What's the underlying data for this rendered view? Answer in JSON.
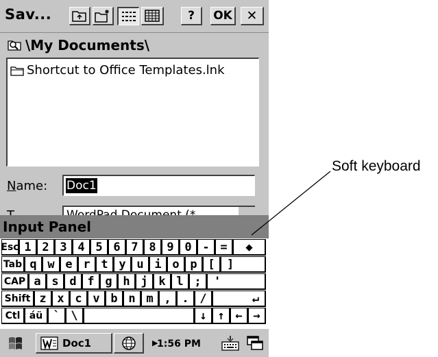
{
  "titlebar": {
    "title": "Sav...",
    "buttons": [
      {
        "name": "up-folder",
        "icon": "up-folder-icon"
      },
      {
        "name": "new-folder",
        "icon": "new-folder-icon"
      },
      {
        "name": "list-view",
        "icon": "list-view-icon",
        "pressed": true
      },
      {
        "name": "details-view",
        "icon": "details-view-icon"
      }
    ],
    "help_label": "?",
    "ok_label": "OK",
    "close_label": "✕"
  },
  "location": {
    "path": "\\My Documents\\"
  },
  "files": [
    {
      "name": "Shortcut to Office Templates.lnk",
      "icon": "folder-shortcut-icon"
    }
  ],
  "name_field": {
    "label_underlined": "N",
    "label_rest": "ame:",
    "value": "Doc1"
  },
  "type_field": {
    "label_visible": "T",
    "value_visible": "WordPad Document (*"
  },
  "input_panel": {
    "title": "Input Panel"
  },
  "keyboard": {
    "rows": [
      [
        "Esc",
        "1",
        "2",
        "3",
        "4",
        "5",
        "6",
        "7",
        "8",
        "9",
        "0",
        "-",
        "=",
        "◆"
      ],
      [
        "Tab",
        "q",
        "w",
        "e",
        "r",
        "t",
        "y",
        "u",
        "i",
        "o",
        "p",
        "[",
        "]"
      ],
      [
        "CAP",
        "a",
        "s",
        "d",
        "f",
        "g",
        "h",
        "j",
        "k",
        "l",
        ";",
        "'"
      ],
      [
        "Shift",
        "z",
        "x",
        "c",
        "v",
        "b",
        "n",
        "m",
        ",",
        ".",
        "/",
        "↵"
      ],
      [
        "Ctl",
        "áü",
        "`",
        "\\",
        "",
        "↓",
        "↑",
        "←",
        "→"
      ]
    ]
  },
  "taskbar": {
    "start_icon": "windows-start-icon",
    "task_label": "Doc1",
    "task_icon": "wordpad-icon",
    "network_icon": "globe-icon",
    "clock": "1:56 PM",
    "keyboard_icon": "keyboard-icon",
    "desktop_icon": "desktop-switch-icon"
  },
  "callout": {
    "text": "Soft keyboard"
  }
}
